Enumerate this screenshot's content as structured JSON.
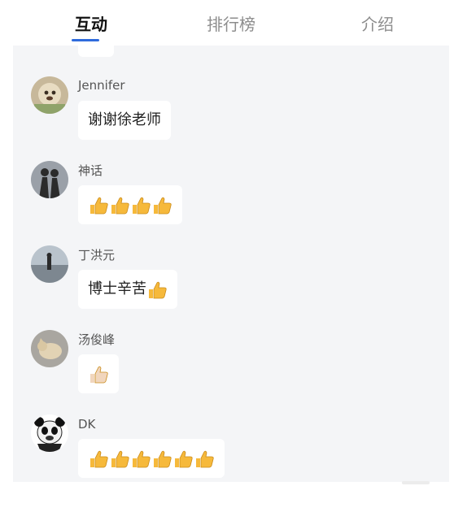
{
  "tabs": [
    {
      "label": "互动",
      "active": true
    },
    {
      "label": "排行榜",
      "active": false
    },
    {
      "label": "介绍",
      "active": false
    }
  ],
  "accent_color": "#2f6bdc",
  "thumb_colors": {
    "yellow": "#f6b93b",
    "light": "#f1d6bd"
  },
  "messages": [
    {
      "name": "Jennifer",
      "text": "谢谢徐老师",
      "thumbs": 0,
      "avatar_icon": "dog-photo-avatar"
    },
    {
      "name": "神话",
      "text": "",
      "thumbs": 4,
      "avatar_icon": "couple-silhouette-avatar"
    },
    {
      "name": "丁洪元",
      "text": "博士辛苦",
      "thumbs": 1,
      "avatar_icon": "lake-person-avatar"
    },
    {
      "name": "汤俊峰",
      "text": "",
      "thumbs": 1,
      "thumb_tone": "light",
      "avatar_icon": "cat-photo-avatar"
    },
    {
      "name": "DK",
      "text": "",
      "thumbs": 6,
      "avatar_icon": "panda-meme-avatar"
    }
  ]
}
